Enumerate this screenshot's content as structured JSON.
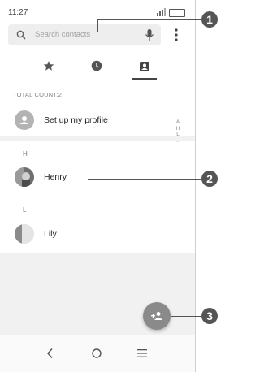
{
  "status_bar": {
    "time": "11:27",
    "battery_icon": "battery-icon",
    "signal_icon": "signal-icon"
  },
  "search": {
    "placeholder": "Search contacts",
    "icon": "search-icon",
    "mic_icon": "mic-icon"
  },
  "menu": {
    "icon": "more-vert-icon"
  },
  "tabs": [
    {
      "icon": "star-icon",
      "active": false
    },
    {
      "icon": "clock-icon",
      "active": false
    },
    {
      "icon": "contact-card-icon",
      "active": true
    }
  ],
  "total_count": "TOTAL COUNT:2",
  "profile": {
    "label": "Set up my profile"
  },
  "sections": [
    {
      "letter": "H",
      "contacts": [
        {
          "name": "Henry"
        }
      ]
    },
    {
      "letter": "L",
      "contacts": [
        {
          "name": "Lily"
        }
      ]
    }
  ],
  "index_letters": [
    "&",
    "H",
    "L",
    "#"
  ],
  "fab": {
    "icon": "add-contact-icon"
  },
  "nav": {
    "back": "back-icon",
    "home": "home-icon",
    "recents": "menu-icon"
  },
  "callouts": [
    "1",
    "2",
    "3"
  ],
  "colors": {
    "accent": "#8a8a8a",
    "gray_bg": "#f1f1f1"
  }
}
